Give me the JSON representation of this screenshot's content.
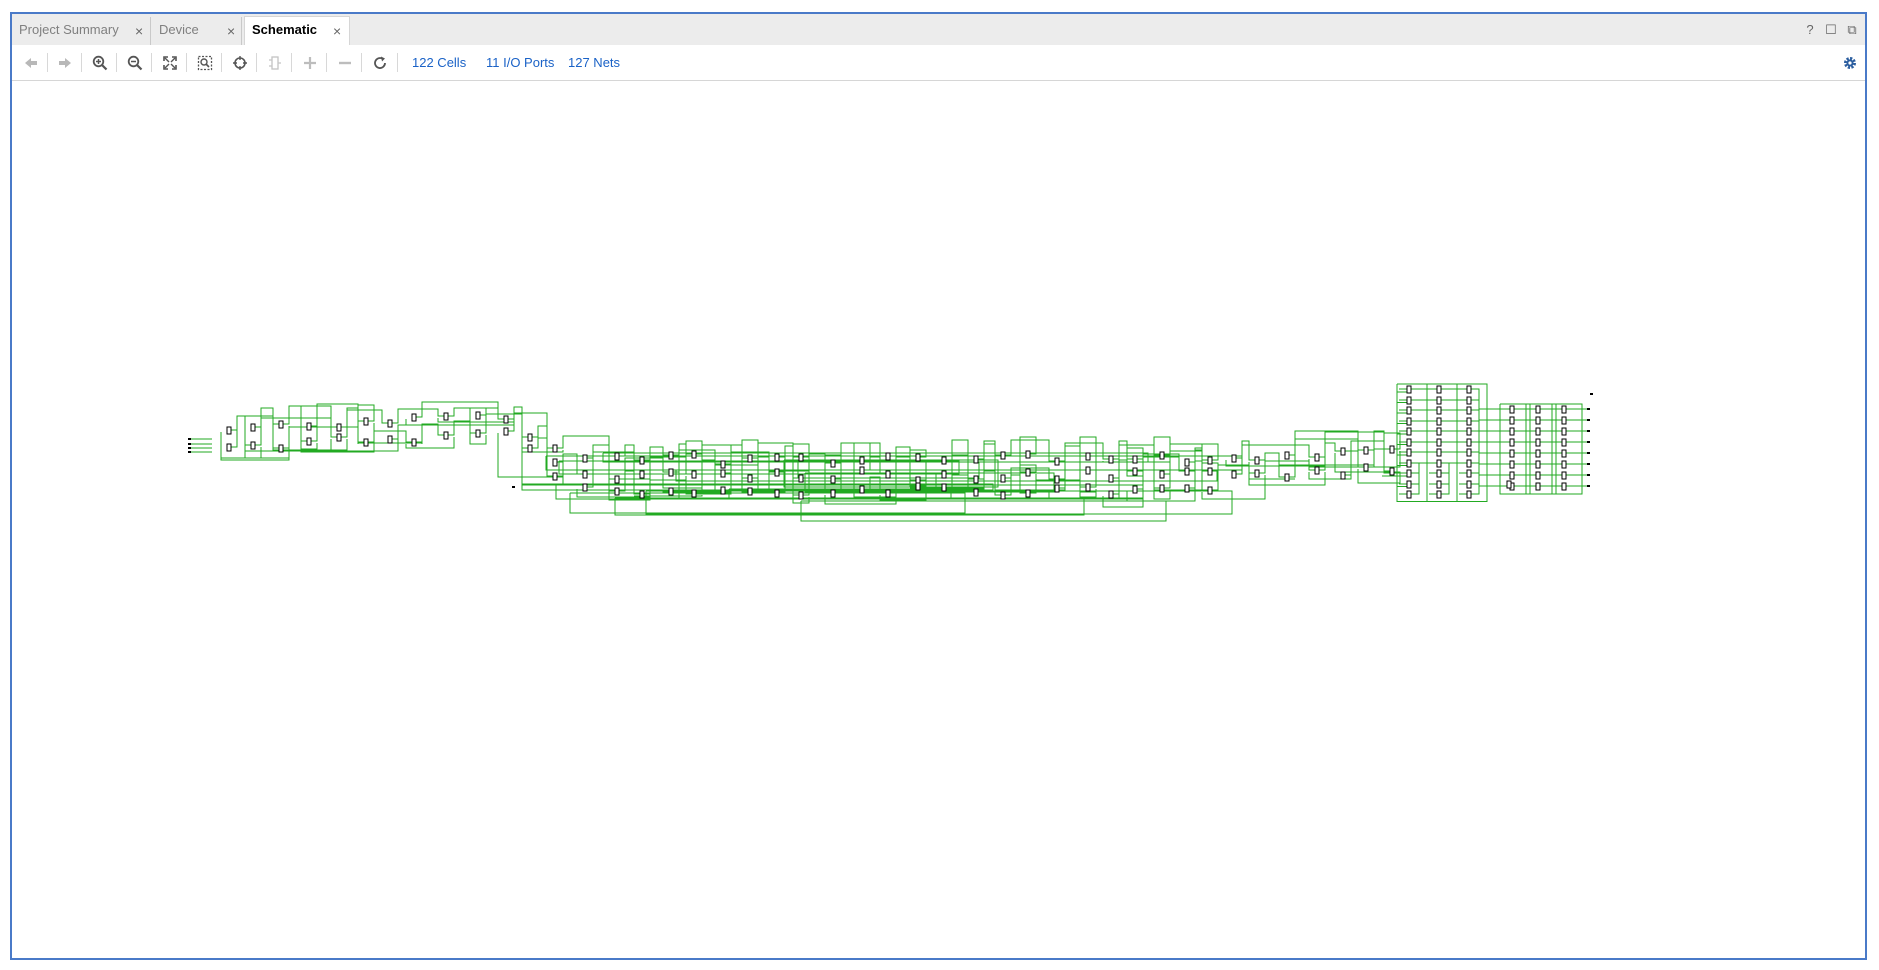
{
  "tabs": [
    {
      "label": "Project Summary",
      "active": false
    },
    {
      "label": "Device",
      "active": false
    },
    {
      "label": "Schematic",
      "active": true
    }
  ],
  "window_controls": {
    "help": "?",
    "maximize": "☐",
    "float": "⧉"
  },
  "toolbar": {
    "icons": [
      "back-icon",
      "forward-icon",
      "zoom-in-icon",
      "zoom-out-icon",
      "zoom-fit-icon",
      "zoom-area-icon",
      "autofit-selection-icon",
      "expand-cone-icon",
      "add-icon",
      "remove-icon",
      "refresh-icon"
    ],
    "cells_label": "122 Cells",
    "ports_label": "11 I/O Ports",
    "nets_label": "127 Nets"
  },
  "schematic": {
    "cells": 122,
    "io_ports": 11,
    "nets": 127,
    "wire_color": "#22aa22",
    "cell_color": "#000000"
  },
  "colors": {
    "frame_border": "#4a7ac8",
    "link": "#1a62c7",
    "tab_bar": "#ececec"
  }
}
